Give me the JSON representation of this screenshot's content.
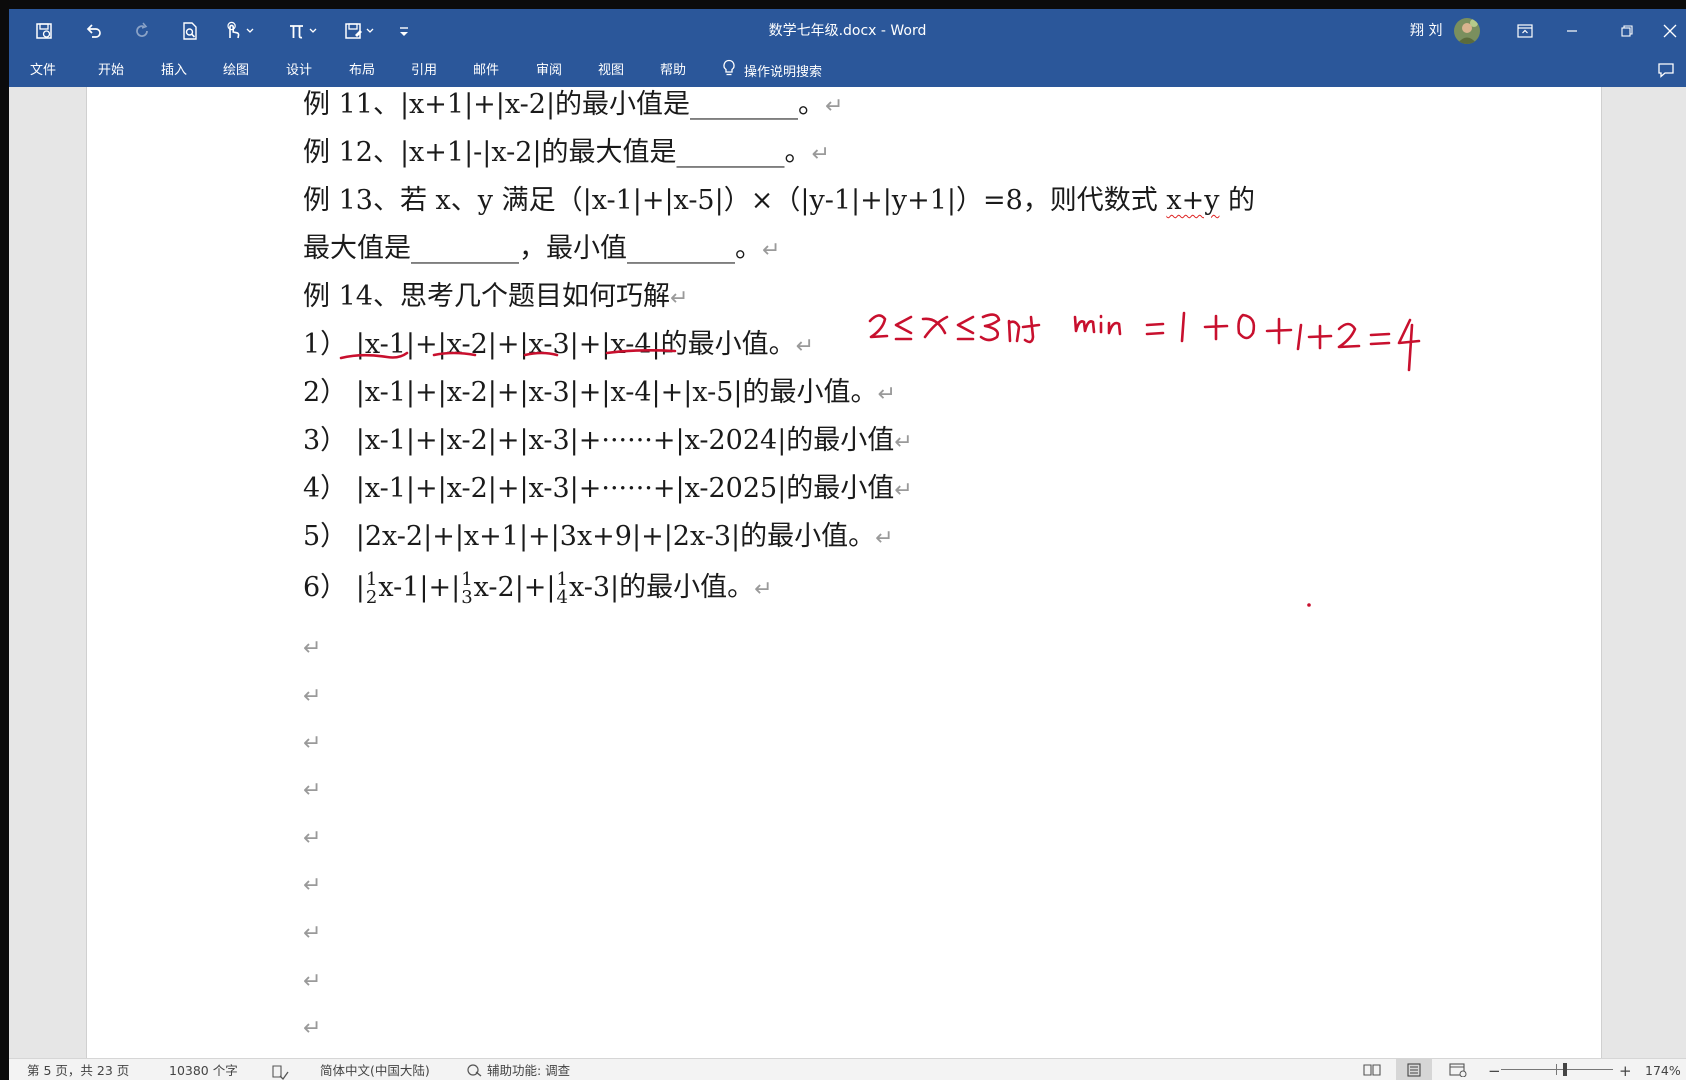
{
  "window": {
    "title": "数学七年级.docx  -  Word",
    "user_name": "翔 刘"
  },
  "ribbon": {
    "tabs": [
      "文件",
      "开始",
      "插入",
      "绘图",
      "设计",
      "布局",
      "引用",
      "邮件",
      "审阅",
      "视图",
      "帮助"
    ],
    "tell_me": "操作说明搜索"
  },
  "document": {
    "ex11": {
      "prefix": "例 11、",
      "expr": "|x+1|+|x-2|",
      "tail": "的最小值是________。"
    },
    "ex12": {
      "prefix": "例 12、",
      "expr": "|x+1|-|x-2|",
      "tail": "的最大值是________。"
    },
    "ex13": {
      "prefix": "例 13、若 x、y 满足（",
      "expr1": "|x-1|+|x-5|",
      "mid": "）×（",
      "expr2": "|y-1|+|y+1|",
      "after": "）=8，则代数式 ",
      "xy": "x+y",
      "end": " 的"
    },
    "ex13b": "最大值是________，最小值________。",
    "ex14": "例 14、思考几个题目如何巧解",
    "item1": {
      "num": "1）",
      "expr": "|x-1|+|x-2|+|x-3|+|x-4|",
      "tail": "的最小值。"
    },
    "item2": {
      "num": "2）",
      "expr": "|x-1|+|x-2|+|x-3|+|x-4|+|x-5|",
      "tail": "的最小值。"
    },
    "item3": {
      "num": "3）",
      "expr": "|x-1|+|x-2|+|x-3|+······+|x-2024|",
      "tail": "的最小值"
    },
    "item4": {
      "num": "4）",
      "expr": "|x-1|+|x-2|+|x-3|+······+|x-2025|",
      "tail": "的最小值"
    },
    "item5": {
      "num": "5）",
      "expr": "|2x-2|+|x+1|+|3x+9|+|2x-3|",
      "tail": "的最小值。"
    },
    "item6": {
      "num": "6）",
      "t1_num": "1",
      "t1_den": "2",
      "t1_rest": "x-1|+|",
      "t2_num": "1",
      "t2_den": "3",
      "t2_rest": "x-2|+|",
      "t3_num": "1",
      "t3_den": "4",
      "t3_rest": "x-3|",
      "tail": "的最小值。"
    },
    "paragraph_mark": "↵",
    "handwriting": "2≤x≤3时  min = 1+0+1+2 = 4"
  },
  "statusbar": {
    "page": "第 5 页，共 23 页",
    "words": "10380 个字",
    "language": "简体中文(中国大陆)",
    "accessibility": "辅助功能: 调查",
    "zoom": "174%",
    "zoom_minus": "−",
    "zoom_plus": "+"
  },
  "colors": {
    "ribbon": "#2b579a",
    "ink": "#c8102e"
  }
}
